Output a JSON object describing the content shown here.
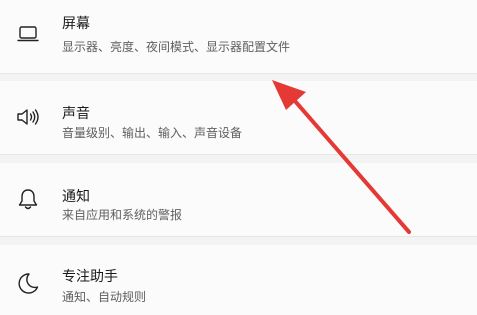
{
  "settings": {
    "items": [
      {
        "title": "屏幕",
        "subtitle": "显示器、亮度、夜间模式、显示器配置文件",
        "icon": "monitor-icon"
      },
      {
        "title": "声音",
        "subtitle": "音量级别、输出、输入、声音设备",
        "icon": "speaker-icon"
      },
      {
        "title": "通知",
        "subtitle": "来自应用和系统的警报",
        "icon": "bell-icon"
      },
      {
        "title": "专注助手",
        "subtitle": "通知、自动规则",
        "icon": "moon-icon"
      }
    ]
  },
  "annotation": {
    "arrow_color": "#e53935"
  },
  "colors": {
    "background": "#f3f3f3",
    "card": "#fbfbfb",
    "title": "#1a1a1a",
    "subtitle": "#5f5f5f"
  }
}
